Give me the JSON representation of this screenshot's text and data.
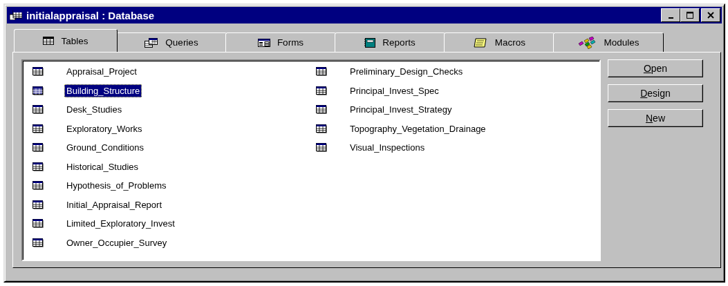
{
  "window": {
    "title": "initialappraisal : Database"
  },
  "tabs": [
    {
      "label": "Tables",
      "selected": true,
      "kind": "table"
    },
    {
      "label": "Queries",
      "selected": false,
      "kind": "query"
    },
    {
      "label": "Forms",
      "selected": false,
      "kind": "form"
    },
    {
      "label": "Reports",
      "selected": false,
      "kind": "report"
    },
    {
      "label": "Macros",
      "selected": false,
      "kind": "macro"
    },
    {
      "label": "Modules",
      "selected": false,
      "kind": "module"
    }
  ],
  "tables": [
    {
      "name": "Appraisal_Project",
      "selected": false
    },
    {
      "name": "Building_Structure",
      "selected": true
    },
    {
      "name": "Desk_Studies",
      "selected": false
    },
    {
      "name": "Exploratory_Works",
      "selected": false
    },
    {
      "name": "Ground_Conditions",
      "selected": false
    },
    {
      "name": "Historical_Studies",
      "selected": false
    },
    {
      "name": "Hypothesis_of_Problems",
      "selected": false
    },
    {
      "name": "Initial_Appraisal_Report",
      "selected": false
    },
    {
      "name": "Limited_Exploratory_Invest",
      "selected": false
    },
    {
      "name": "Owner_Occupier_Survey",
      "selected": false
    },
    {
      "name": "Preliminary_Design_Checks",
      "selected": false
    },
    {
      "name": "Principal_Invest_Spec",
      "selected": false
    },
    {
      "name": "Principal_Invest_Strategy",
      "selected": false
    },
    {
      "name": "Topography_Vegetation_Drainage",
      "selected": false
    },
    {
      "name": "Visual_Inspections",
      "selected": false
    }
  ],
  "buttons": [
    {
      "label": "Open",
      "underline_first": true
    },
    {
      "label": "Design",
      "underline_first": true
    },
    {
      "label": "New",
      "underline_first": true
    }
  ]
}
